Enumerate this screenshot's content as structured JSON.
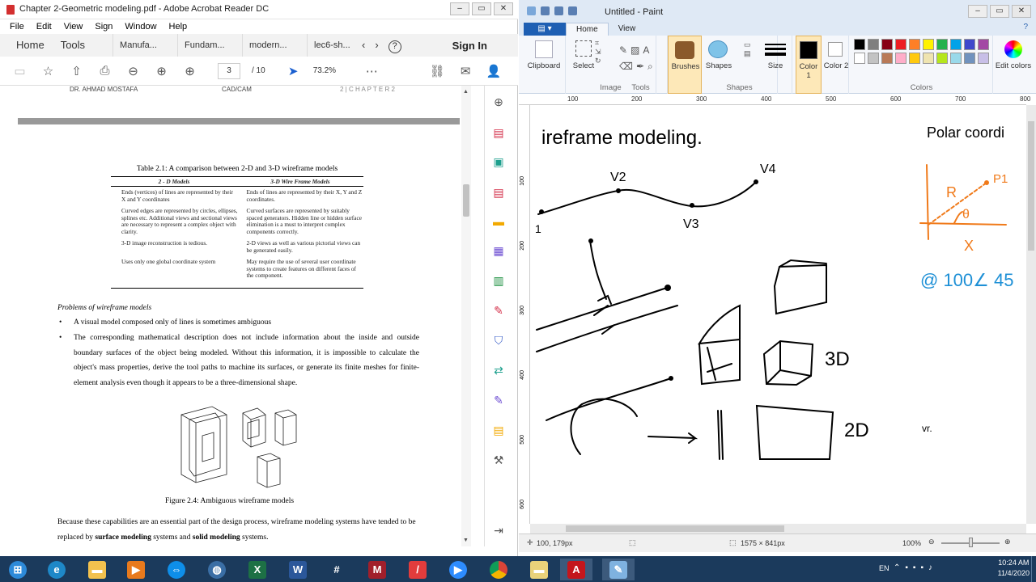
{
  "acrobat": {
    "title": "Chapter 2-Geometric modeling.pdf - Adobe Acrobat Reader DC",
    "menu": [
      "File",
      "Edit",
      "View",
      "Sign",
      "Window",
      "Help"
    ],
    "nav": {
      "home": "Home",
      "tools": "Tools",
      "tabs": [
        "Manufa...",
        "Fundam...",
        "modern...",
        "lec6-sh..."
      ],
      "help": "?",
      "signin": "Sign In"
    },
    "toolbar": {
      "page_current": "3",
      "page_total": "/ 10",
      "zoom": "73.2%"
    },
    "page": {
      "header_left": "DR. AHMAD MOSTAFA",
      "header_mid": "CAD/CAM",
      "header_right": "2 | C H A P T E R  2",
      "table_title": "Table 2.1: A comparison between 2-D and 3-D wireframe models",
      "table_headers": [
        "2 - D Models",
        "3-D Wire Frame Models"
      ],
      "table_rows": [
        [
          "Ends (vertices) of lines are represented by their X and Y coordinates",
          "Ends of lines are represented by their X, Y and Z coordinates."
        ],
        [
          "Curved edges are represented by circles, ellipses, splines etc. Additional views and sectional views are necessary to represent a complex object with clarity.",
          "Curved surfaces are represented by suitably spaced generators. Hidden line or hidden surface elimination is a must to interpret complex components correctly."
        ],
        [
          "3-D image reconstruction is tedious.",
          "2-D views as well as various pictorial views can be generated easily."
        ],
        [
          "Uses only one global coordinate system",
          "May require the use of several user coordinate systems to create features on different faces of the component."
        ]
      ],
      "section_heading": "Problems of wireframe models",
      "bullet1": "A visual model composed only of lines is sometimes ambiguous",
      "bullet2": "The corresponding mathematical description does not include information about the inside and outside boundary surfaces of the object being modeled. Without this information, it is impossible to calculate the object's mass properties, derive the tool paths to machine its surfaces, or generate its finite meshes for finite-element analysis even though it appears to be a three-dimensional shape.",
      "figure_caption": "Figure 2.4: Ambiguous wireframe models",
      "para_start": "Because these capabilities are an essential part of the design process, wireframe modeling systems have tended to be replaced by ",
      "para_bold1": "surface modeling",
      "para_mid": " systems and ",
      "para_bold2": "solid modeling",
      "para_end": " systems."
    }
  },
  "paint": {
    "title": "Untitled - Paint",
    "tabs": {
      "file": "",
      "home": "Home",
      "view": "View"
    },
    "groups": {
      "clipboard": "Clipboard",
      "image": "Image",
      "tools": "Tools",
      "shapes": "Shapes",
      "colors": "Colors"
    },
    "buttons": {
      "clipboard": "Clipboard",
      "select": "Select",
      "brushes": "Brushes",
      "shapes": "Shapes",
      "size": "Size",
      "color1": "Color 1",
      "color2": "Color 2",
      "edit_colors": "Edit colors"
    },
    "ruler_ticks": [
      "100",
      "200",
      "300",
      "400",
      "500",
      "600",
      "700",
      "800"
    ],
    "ruler_v_ticks": [
      "100",
      "200",
      "300",
      "400",
      "500",
      "600"
    ],
    "palette": [
      "#000000",
      "#7f7f7f",
      "#880015",
      "#ed1c24",
      "#ff7f27",
      "#fff200",
      "#22b14c",
      "#00a2e8",
      "#3f48cc",
      "#a349a4",
      "#ffffff",
      "#c3c3c3",
      "#b97a57",
      "#ffaec9",
      "#ffc90e",
      "#efe4b0",
      "#b5e61d",
      "#99d9ea",
      "#7092be",
      "#c8bfe7"
    ],
    "drawing_text": {
      "wireframe": "ireframe modeling.",
      "v2": "V2",
      "v3": "V3",
      "v4": "V4",
      "v1": "1",
      "polar": "Polar coordi",
      "p1": "P1",
      "r": "R",
      "theta": "θ",
      "x": "X",
      "polar_at": "@ 100∠ 45",
      "td3": "3D",
      "td2": "2D",
      "vr": "vr."
    },
    "status": {
      "position": "100, 179px",
      "dimensions": "1575 × 841px",
      "zoom": "100%"
    }
  },
  "taskbar": {
    "lang": "EN",
    "time": "10:24 AM",
    "date": "11/4/2020"
  }
}
